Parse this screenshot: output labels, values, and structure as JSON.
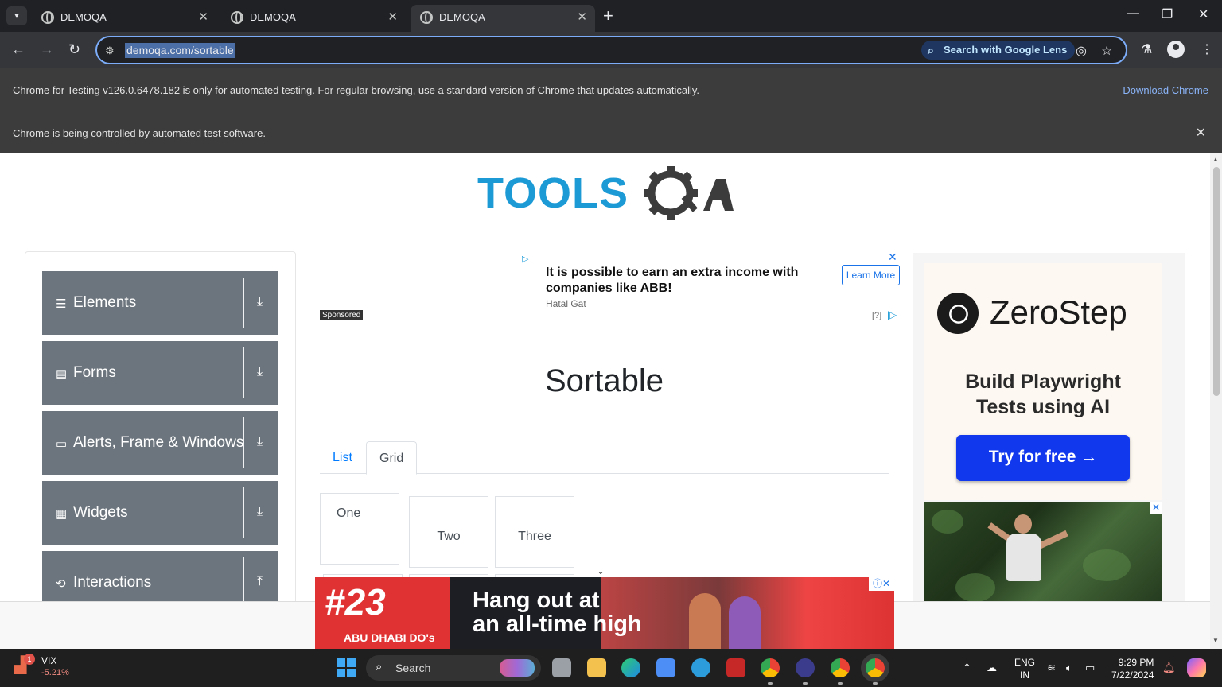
{
  "browser": {
    "tabs": [
      {
        "title": "DEMOQA"
      },
      {
        "title": "DEMOQA"
      },
      {
        "title": "DEMOQA"
      }
    ],
    "url": "demoqa.com/sortable",
    "lens_label": "Search with Google Lens",
    "info_testing": "Chrome for Testing v126.0.6478.182 is only for automated testing. For regular browsing, use a standard version of Chrome that updates automatically.",
    "download_link": "Download Chrome",
    "info_automation": "Chrome is being controlled by automated test software."
  },
  "logo_text": "TOOLSQA",
  "sidebar": {
    "groups": [
      {
        "label": "Elements",
        "icon": "menu-icon"
      },
      {
        "label": "Forms",
        "icon": "document-icon"
      },
      {
        "label": "Alerts, Frame & Windows",
        "icon": "window-icon"
      },
      {
        "label": "Widgets",
        "icon": "widgets-icon"
      },
      {
        "label": "Interactions",
        "icon": "interactions-icon"
      }
    ]
  },
  "ad_top": {
    "headline": "It is possible to earn an extra income with companies like ABB!",
    "advertiser": "Hatal Gat",
    "cta": "Learn More",
    "sponsored": "Sponsored",
    "help": "[?]"
  },
  "page": {
    "title": "Sortable",
    "tabs": {
      "list": "List",
      "grid": "Grid"
    },
    "grid_items": [
      "One",
      "Two",
      "Three"
    ]
  },
  "ad_right": {
    "brand": "ZeroStep",
    "tagline_1": "Build Playwright",
    "tagline_2": "Tests using AI",
    "cta": "Try for free →"
  },
  "ad_bottom": {
    "number": "#23",
    "brand": "ABU DHABI DO's",
    "headline_1": "Hang out at",
    "headline_2": "an all-time high"
  },
  "taskbar": {
    "widget_title": "VIX",
    "widget_value": "-5.21%",
    "widget_badge": "1",
    "search_label": "Search",
    "lang_1": "ENG",
    "lang_2": "IN",
    "time": "9:29 PM",
    "date": "7/22/2024"
  },
  "colors": {
    "sidebar_group": "#6c757d",
    "link_blue": "#007bff",
    "logo_blue": "#1b9ad6",
    "logo_dark": "#3c3c3c",
    "zerostep_button": "#1238ee"
  }
}
